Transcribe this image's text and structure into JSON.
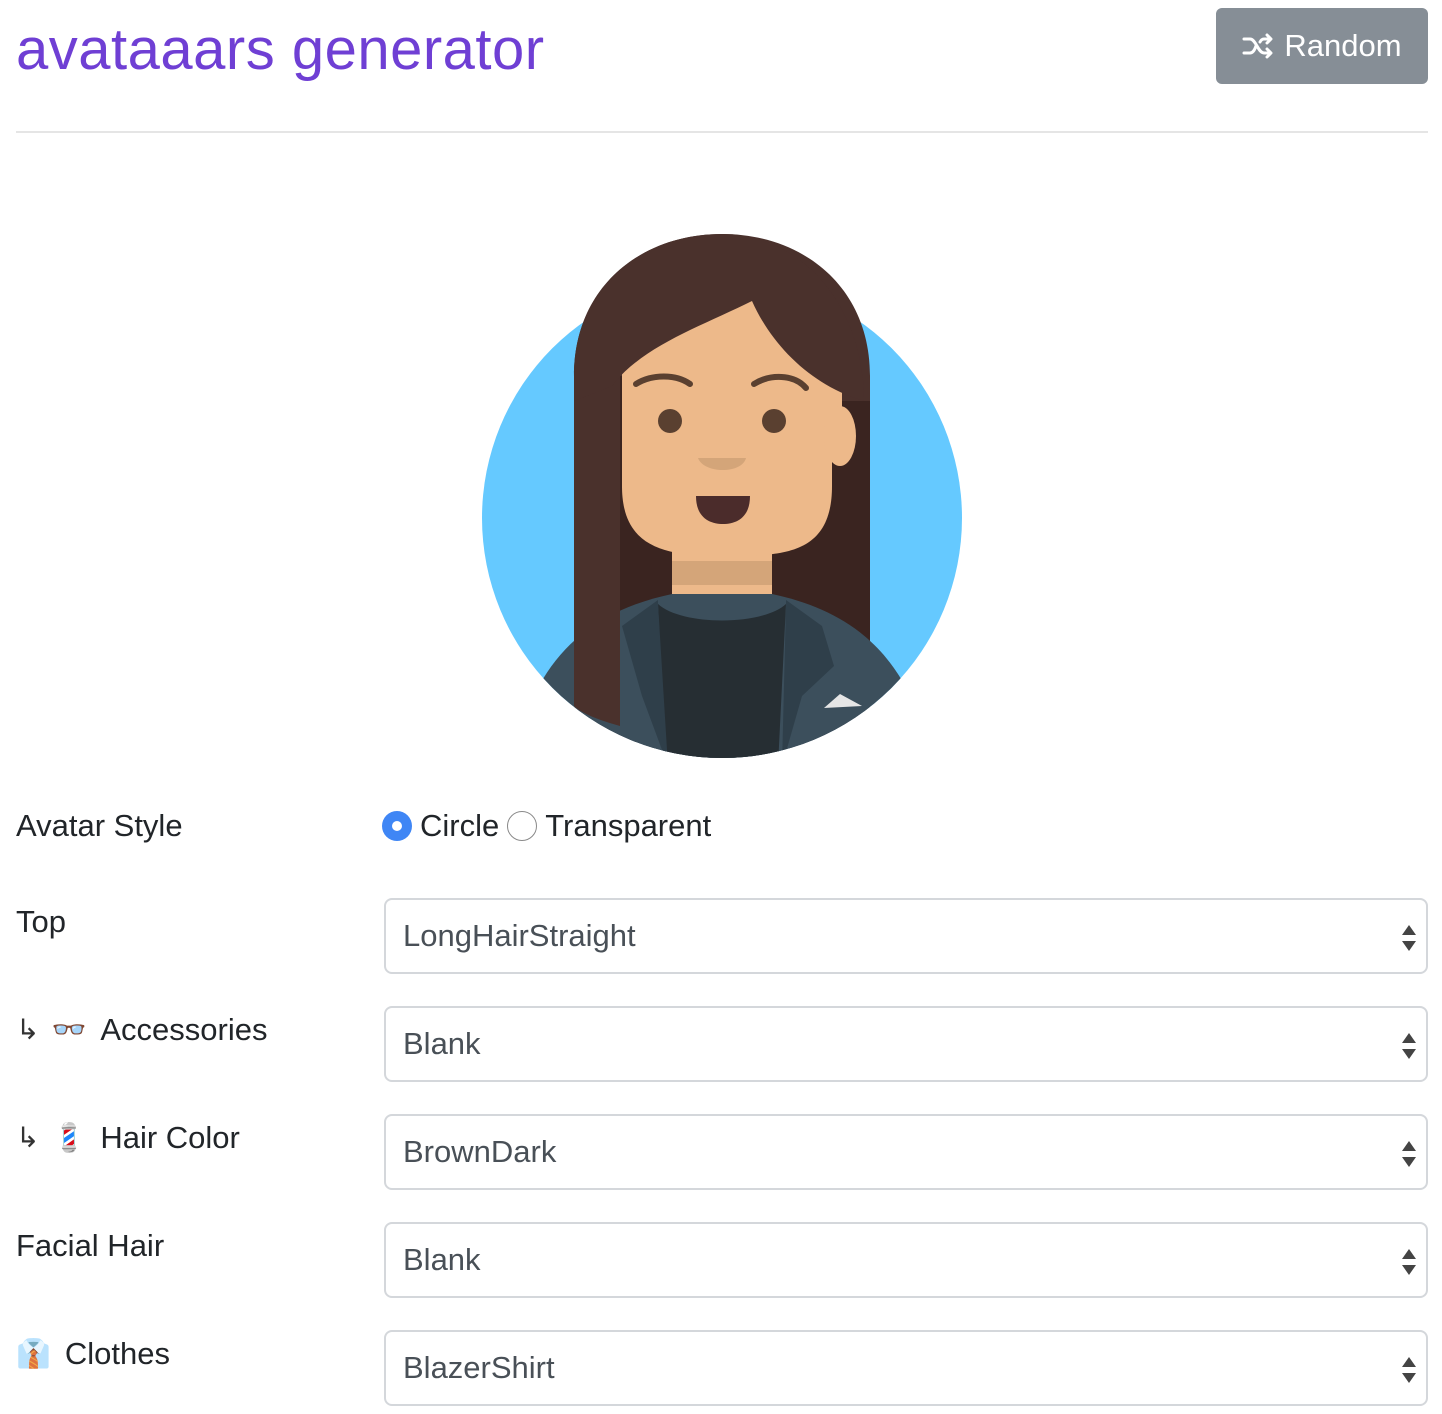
{
  "header": {
    "title": "avataaars generator",
    "random_label": "Random"
  },
  "colors": {
    "title": "#6f3fd4",
    "button_bg": "#868e96",
    "radio_selected": "#3f86f5",
    "avatar_bg": "#65c9ff",
    "hair": "#4a312c",
    "skin": "#edb98a",
    "blazer": "#3c4f5c",
    "shirt": "#262e33"
  },
  "form": {
    "avatar_style": {
      "label": "Avatar Style",
      "options": [
        "Circle",
        "Transparent"
      ],
      "selected": "Circle"
    },
    "top": {
      "label": "Top",
      "value": "LongHairStraight"
    },
    "accessories": {
      "arrow": "↳",
      "icon": "👓",
      "label": "Accessories",
      "value": "Blank"
    },
    "hair_color": {
      "arrow": "↳",
      "icon": "💈",
      "label": "Hair Color",
      "value": "BrownDark"
    },
    "facial_hair": {
      "label": "Facial Hair",
      "value": "Blank"
    },
    "clothes": {
      "icon": "👔",
      "label": "Clothes",
      "value": "BlazerShirt"
    }
  }
}
